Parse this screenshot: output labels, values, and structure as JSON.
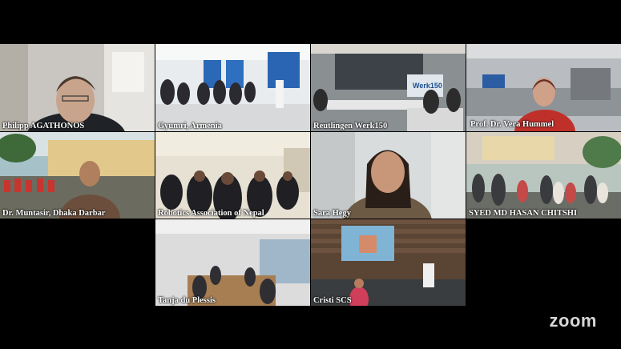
{
  "app": {
    "brand": "zoom"
  },
  "participants": [
    {
      "name": "Philipp AGATHONOS",
      "active": false
    },
    {
      "name": "Gyumri, Armenia",
      "active": false
    },
    {
      "name": "Reutlingen Werk150",
      "active": false
    },
    {
      "name": "Prof. Dr. Vera Hummel",
      "active": true
    },
    {
      "name": "Dr. Muntasir, Dhaka Darbar",
      "active": false
    },
    {
      "name": "Robotics Association of Nepal",
      "active": false
    },
    {
      "name": "Sara Hegy",
      "active": false
    },
    {
      "name": "SYED MD HASAN CHITSHI",
      "active": false
    },
    {
      "name": "Tanja du Plessis",
      "active": false
    },
    {
      "name": "Cristi SCS",
      "active": false
    }
  ],
  "scene_text": {
    "werk150_screen": "Werk150"
  },
  "colors": {
    "active_speaker_border": "#39c63b",
    "background": "#000000"
  }
}
